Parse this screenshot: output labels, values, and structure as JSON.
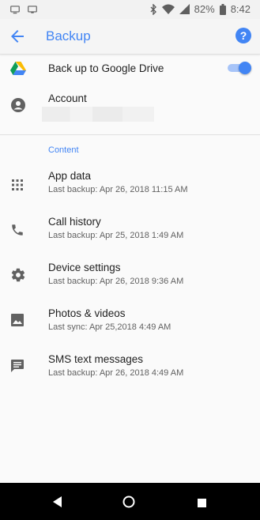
{
  "status_bar": {
    "battery": "82%",
    "time": "8:42",
    "icons": [
      "cast-screen-icon",
      "desktop-icon",
      "bluetooth-icon",
      "wifi-icon",
      "signal-icon",
      "battery-icon"
    ]
  },
  "app_bar": {
    "title": "Backup",
    "back_icon": "arrow-back-icon",
    "help_icon": "help-icon"
  },
  "backup_toggle": {
    "label": "Back up to Google Drive",
    "enabled": true,
    "icon": "google-drive-icon"
  },
  "account": {
    "label": "Account",
    "icon": "account-circle-icon"
  },
  "content_section": {
    "header": "Content",
    "items": [
      {
        "label": "App data",
        "sub": "Last backup: Apr 26, 2018 11:15 AM",
        "icon": "apps-grid-icon"
      },
      {
        "label": "Call history",
        "sub": "Last backup: Apr 25, 2018 1:49 AM",
        "icon": "phone-icon"
      },
      {
        "label": "Device settings",
        "sub": "Last backup: Apr 26, 2018 9:36 AM",
        "icon": "gear-icon"
      },
      {
        "label": "Photos & videos",
        "sub": "Last sync: Apr 25,2018 4:49 AM",
        "icon": "photo-icon"
      },
      {
        "label": "SMS text messages",
        "sub": "Last backup: Apr 26, 2018 4:49 AM",
        "icon": "message-icon"
      }
    ]
  },
  "colors": {
    "accent": "#4285f4",
    "background": "#fafafa",
    "icon": "#616161"
  }
}
